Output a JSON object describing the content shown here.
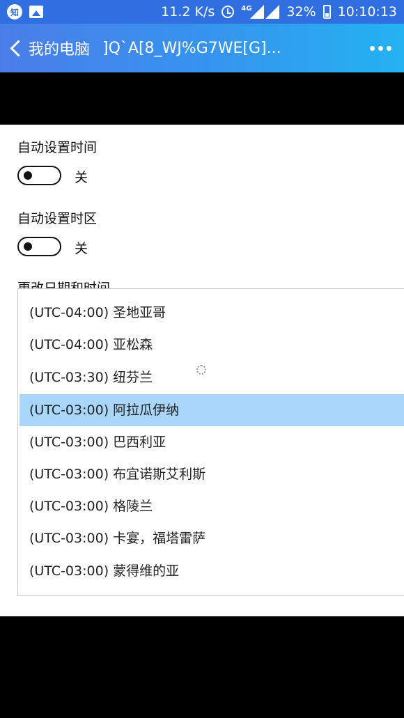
{
  "status_bar": {
    "speed": "11.2 K/s",
    "network_type": "4G",
    "battery": "32%",
    "time": "10:10:13",
    "icons": [
      "zhihu-icon",
      "image-icon",
      "alarm-icon",
      "signal-icon",
      "battery-icon"
    ]
  },
  "title_bar": {
    "back_label": "我的电脑",
    "title": "]Q`A[8_WJ%G7WE[G]..."
  },
  "settings": {
    "auto_time": {
      "label": "自动设置时间",
      "state": "关"
    },
    "auto_timezone": {
      "label": "自动设置时区",
      "state": "关"
    },
    "change_datetime_label": "更改日期和时间"
  },
  "timezone_list": {
    "selected_index": 3,
    "items": [
      "(UTC-04:00) 圣地亚哥",
      "(UTC-04:00) 亚松森",
      "(UTC-03:30) 纽芬兰",
      "(UTC-03:00) 阿拉瓜伊纳",
      "(UTC-03:00) 巴西利亚",
      "(UTC-03:00) 布宜诺斯艾利斯",
      "(UTC-03:00) 格陵兰",
      "(UTC-03:00) 卡宴，福塔雷萨",
      "(UTC-03:00) 蒙得维的亚"
    ]
  },
  "colors": {
    "status_bar": "#2f6fe0",
    "title_gradient_start": "#4a7de8",
    "title_gradient_end": "#24b2f2",
    "selected_item": "#a9d6fb"
  }
}
